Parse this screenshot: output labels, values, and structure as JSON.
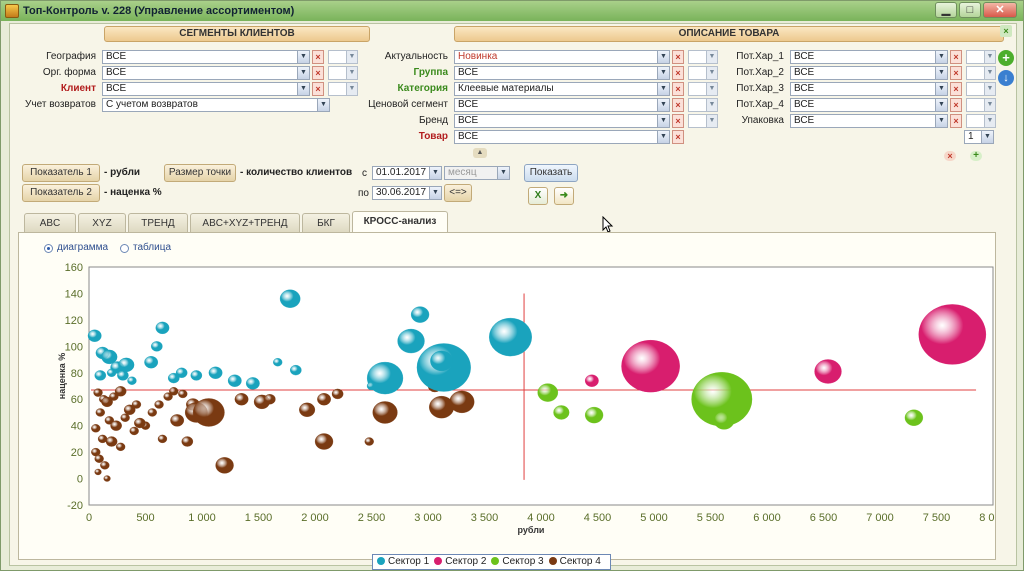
{
  "window": {
    "title": "Топ-Контроль v. 228 (Управление ассортиментом)",
    "minimize": "▁",
    "maximize": "□",
    "close": "✕"
  },
  "filters": {
    "segments_header": "СЕГМЕНТЫ КЛИЕНТОВ",
    "product_header": "ОПИСАНИЕ ТОВАРА",
    "left": [
      {
        "label": "География",
        "value": "ВСЕ"
      },
      {
        "label": "Орг. форма",
        "value": "ВСЕ"
      },
      {
        "label": "Клиент",
        "value": "ВСЕ"
      },
      {
        "label": "Учет возвратов",
        "value": "С учетом возвратов"
      }
    ],
    "middle": [
      {
        "label": "Актуальность",
        "value": "Новинка"
      },
      {
        "label": "Группа",
        "value": "ВСЕ"
      },
      {
        "label": "Категория",
        "value": "Клеевые материалы"
      },
      {
        "label": "Ценовой сегмент",
        "value": "ВСЕ"
      },
      {
        "label": "Бренд",
        "value": "ВСЕ"
      },
      {
        "label": "Товар",
        "value": "ВСЕ"
      }
    ],
    "right": [
      {
        "label": "Пот.Хар_1",
        "value": "ВСЕ"
      },
      {
        "label": "Пот.Хар_2",
        "value": "ВСЕ"
      },
      {
        "label": "Пот.Хар_3",
        "value": "ВСЕ"
      },
      {
        "label": "Пот.Хар_4",
        "value": "ВСЕ"
      },
      {
        "label": "Упаковка",
        "value": "ВСЕ"
      }
    ],
    "qty_value": "1",
    "x_mark": "×",
    "dd_mark": "▼",
    "add_mark": "+",
    "collapse_mark": "▲"
  },
  "controls": {
    "indicator1_btn": "Показатель 1",
    "indicator1_val": "- рубли",
    "indicator2_btn": "Показатель 2",
    "indicator2_val": "- наценка %",
    "pointsize_btn": "Размер точки",
    "pointsize_val": "- количество клиентов",
    "from_label": "с",
    "date_from": "01.01.2017",
    "period": "месяц",
    "to_label": "по",
    "date_to": "30.06.2017",
    "swap_btn": "<=>",
    "show_btn": "Показать"
  },
  "tabs": [
    {
      "label": "ABC"
    },
    {
      "label": "XYZ"
    },
    {
      "label": "ТРЕНД"
    },
    {
      "label": "ABC+XYZ+ТРЕНД"
    },
    {
      "label": "БКГ"
    },
    {
      "label": "КРОСС-анализ"
    }
  ],
  "view": {
    "diagram_label": "диаграмма",
    "table_label": "таблица",
    "selected": "diagram"
  },
  "colors": {
    "sector1": "#1aa3bd",
    "sector2": "#d81e6e",
    "sector3": "#6cc21c",
    "sector4": "#7a3a12",
    "crosshair": "#e04040"
  },
  "chart_data": {
    "type": "scatter",
    "xlabel": "рубли",
    "ylabel": "наценка %",
    "xlim": [
      0,
      8000
    ],
    "ylim": [
      -20,
      160
    ],
    "x_ticks": [
      "0",
      "500",
      "1 000",
      "1 500",
      "2 000",
      "2 500",
      "3 000",
      "3 500",
      "4 000",
      "4 500",
      "5 000",
      "5 500",
      "6 000",
      "6 500",
      "7 000",
      "7 500",
      "8 000"
    ],
    "y_ticks": [
      "160",
      "140",
      "120",
      "100",
      "80",
      "60",
      "40",
      "20",
      "0",
      "-20"
    ],
    "crosshair": {
      "x": 3850,
      "y": 67
    },
    "legend_position": "bottom",
    "series": [
      {
        "name": "Сектор 1",
        "points": [
          [
            50,
            108,
            6
          ],
          [
            120,
            95,
            6
          ],
          [
            180,
            92,
            7
          ],
          [
            250,
            84,
            6
          ],
          [
            330,
            86,
            7
          ],
          [
            550,
            88,
            6
          ],
          [
            650,
            114,
            6
          ],
          [
            600,
            100,
            5
          ],
          [
            820,
            80,
            5
          ],
          [
            950,
            78,
            5
          ],
          [
            1120,
            80,
            6
          ],
          [
            1290,
            74,
            6
          ],
          [
            1450,
            72,
            6
          ],
          [
            1670,
            88,
            4
          ],
          [
            1830,
            82,
            5
          ],
          [
            1780,
            136,
            9
          ],
          [
            2620,
            76,
            16
          ],
          [
            2850,
            104,
            12
          ],
          [
            2930,
            124,
            8
          ],
          [
            3140,
            84,
            24
          ],
          [
            3120,
            89,
            10
          ],
          [
            3730,
            107,
            19
          ],
          [
            100,
            78,
            5
          ],
          [
            200,
            80,
            4
          ],
          [
            300,
            78,
            5
          ],
          [
            380,
            74,
            4
          ],
          [
            750,
            76,
            5
          ],
          [
            2500,
            70,
            4
          ]
        ]
      },
      {
        "name": "Сектор 2",
        "points": [
          [
            4450,
            74,
            6
          ],
          [
            4970,
            85,
            26
          ],
          [
            6540,
            81,
            12
          ],
          [
            7640,
            109,
            30
          ]
        ]
      },
      {
        "name": "Сектор 3",
        "points": [
          [
            4060,
            65,
            9
          ],
          [
            4180,
            50,
            7
          ],
          [
            4470,
            48,
            8
          ],
          [
            5600,
            60,
            27
          ],
          [
            5620,
            44,
            9
          ],
          [
            7300,
            46,
            8
          ]
        ]
      },
      {
        "name": "Сектор 4",
        "points": [
          [
            80,
            65,
            4
          ],
          [
            130,
            60,
            4
          ],
          [
            160,
            58,
            5
          ],
          [
            220,
            62,
            4
          ],
          [
            280,
            66,
            5
          ],
          [
            100,
            50,
            4
          ],
          [
            180,
            44,
            4
          ],
          [
            240,
            40,
            5
          ],
          [
            320,
            46,
            4
          ],
          [
            360,
            52,
            5
          ],
          [
            420,
            56,
            4
          ],
          [
            60,
            38,
            4
          ],
          [
            120,
            30,
            4
          ],
          [
            200,
            28,
            5
          ],
          [
            280,
            24,
            4
          ],
          [
            60,
            20,
            4
          ],
          [
            90,
            15,
            4
          ],
          [
            140,
            10,
            4
          ],
          [
            160,
            0,
            3
          ],
          [
            80,
            5,
            3
          ],
          [
            500,
            40,
            4
          ],
          [
            560,
            50,
            4
          ],
          [
            620,
            56,
            4
          ],
          [
            700,
            62,
            4
          ],
          [
            750,
            66,
            4
          ],
          [
            830,
            64,
            4
          ],
          [
            920,
            56,
            6
          ],
          [
            950,
            50,
            10
          ],
          [
            1060,
            50,
            14
          ],
          [
            1200,
            10,
            8
          ],
          [
            1350,
            60,
            6
          ],
          [
            1530,
            58,
            7
          ],
          [
            1600,
            60,
            5
          ],
          [
            1930,
            52,
            7
          ],
          [
            2080,
            60,
            6
          ],
          [
            2200,
            64,
            5
          ],
          [
            2480,
            28,
            4
          ],
          [
            2620,
            50,
            11
          ],
          [
            3060,
            70,
            6
          ],
          [
            3120,
            54,
            11
          ],
          [
            3300,
            58,
            11
          ],
          [
            2080,
            28,
            8
          ],
          [
            780,
            44,
            6
          ],
          [
            870,
            28,
            5
          ],
          [
            650,
            30,
            4
          ],
          [
            400,
            36,
            4
          ],
          [
            450,
            42,
            5
          ]
        ]
      }
    ]
  }
}
